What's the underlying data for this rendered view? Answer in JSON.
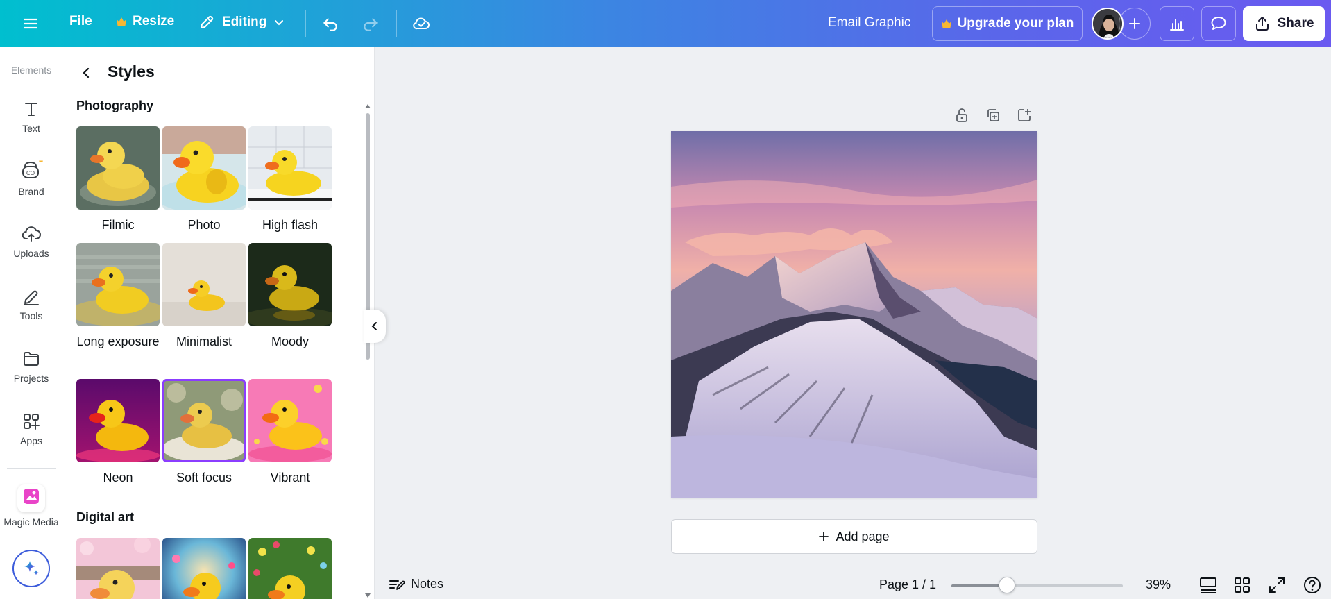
{
  "topbar": {
    "file_label": "File",
    "resize_label": "Resize",
    "editing_label": "Editing",
    "design_title": "Email Graphic",
    "upgrade_label": "Upgrade your plan",
    "share_label": "Share",
    "icons": [
      "menu-icon",
      "crown-icon",
      "pencil-icon",
      "chevron-down-icon",
      "undo-icon",
      "redo-icon",
      "cloud-check-icon",
      "plus-icon",
      "analytics-icon",
      "comment-icon",
      "share-icon"
    ]
  },
  "rail": {
    "items": [
      {
        "label": "Elements",
        "icon": "elements-icon"
      },
      {
        "label": "Text",
        "icon": "text-icon"
      },
      {
        "label": "Brand",
        "icon": "brand-icon"
      },
      {
        "label": "Uploads",
        "icon": "upload-cloud-icon"
      },
      {
        "label": "Tools",
        "icon": "tools-icon"
      },
      {
        "label": "Projects",
        "icon": "folder-icon"
      },
      {
        "label": "Apps",
        "icon": "apps-icon"
      },
      {
        "label": "Magic Media",
        "icon": "magic-media-icon"
      }
    ],
    "assistant_icon": "sparkle-icon"
  },
  "panel": {
    "title": "Styles",
    "photography_title": "Photography",
    "digital_art_title": "Digital art",
    "styles": [
      {
        "label": "Filmic",
        "selected": false
      },
      {
        "label": "Photo",
        "selected": false
      },
      {
        "label": "High flash",
        "selected": false
      },
      {
        "label": "Long exposure",
        "selected": false
      },
      {
        "label": "Minimalist",
        "selected": false
      },
      {
        "label": "Moody",
        "selected": false
      },
      {
        "label": "Neon",
        "selected": true
      },
      {
        "label": "Soft focus",
        "selected": true
      },
      {
        "label": "Vibrant",
        "selected": false
      }
    ],
    "selected_color": "#8b3dff"
  },
  "canvas": {
    "add_page_label": "Add page",
    "tool_icons": [
      "lock-icon",
      "duplicate-icon",
      "add-page-icon"
    ]
  },
  "bottombar": {
    "notes_label": "Notes",
    "page_indicator": "Page 1 / 1",
    "zoom_label": "39%",
    "zoom_value": 39,
    "icons": [
      "notes-icon",
      "page-view-icon",
      "grid-view-icon",
      "fullscreen-icon",
      "help-icon"
    ]
  }
}
